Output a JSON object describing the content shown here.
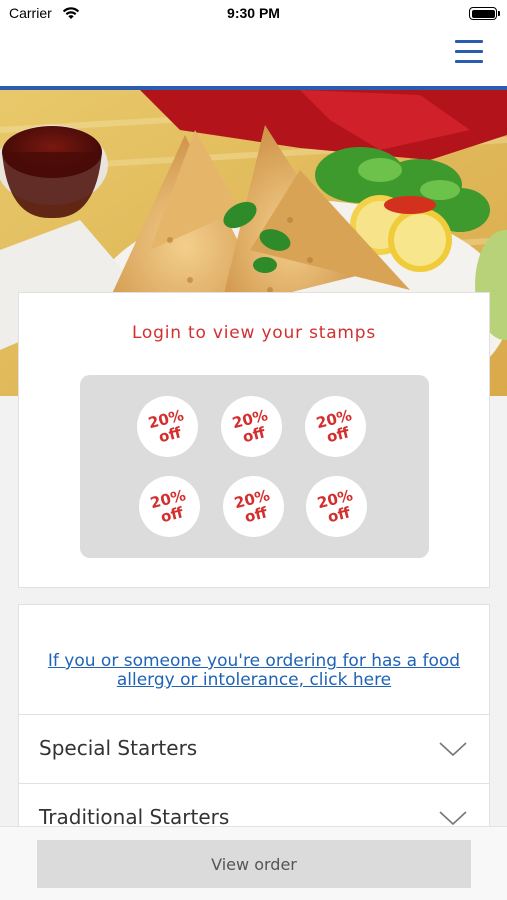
{
  "status_bar": {
    "carrier": "Carrier",
    "time": "9:30 PM",
    "wifi_icon": "wifi-icon",
    "battery_icon": "battery-icon"
  },
  "nav": {
    "menu_icon": "hamburger-menu-icon",
    "accent_color": "#2a5db0"
  },
  "hero": {
    "image_icon": "food-photo"
  },
  "stamps": {
    "title": "Login to view your stamps",
    "title_color": "#d32f2f",
    "items": [
      {
        "line1": "20%",
        "line2": "off"
      },
      {
        "line1": "20%",
        "line2": "off"
      },
      {
        "line1": "20%",
        "line2": "off"
      },
      {
        "line1": "20%",
        "line2": "off"
      },
      {
        "line1": "20%",
        "line2": "off"
      },
      {
        "line1": "20%",
        "line2": "off"
      }
    ]
  },
  "allergy": {
    "link_text": "If you or someone you're ordering for has a food allergy or intolerance, click here",
    "link_color": "#1e63b6"
  },
  "menu": {
    "categories": [
      {
        "label": "Special Starters",
        "icon": "chevron-down-icon"
      },
      {
        "label": "Traditional Starters",
        "icon": "chevron-down-icon"
      }
    ]
  },
  "footer": {
    "view_order_label": "View order"
  }
}
